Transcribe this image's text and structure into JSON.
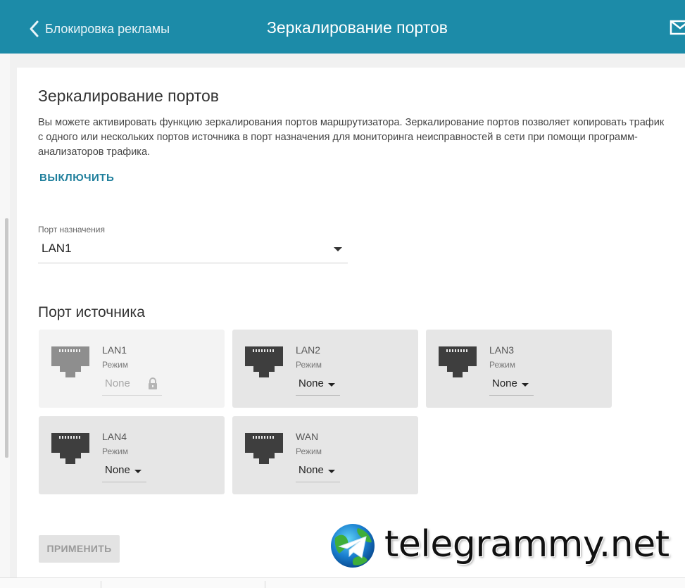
{
  "header": {
    "back_label": "Блокировка рекламы",
    "title": "Зеркалирование портов",
    "accent_color": "#1c8ba8"
  },
  "main": {
    "section_title": "Зеркалирование портов",
    "description": "Вы можете активировать функцию зеркалирования портов маршрутизатора. Зеркалирование портов позволяет копировать трафик с одного или нескольких портов источника в порт назначения для мониторинга неисправностей в сети при помощи программ-анализаторов трафика.",
    "disable_label": "ВЫКЛЮЧИТЬ",
    "destination": {
      "label": "Порт назначения",
      "value": "LAN1"
    },
    "source_title": "Порт источника",
    "ports": [
      {
        "name": "LAN1",
        "mode_label": "Режим",
        "value": "None",
        "disabled": true
      },
      {
        "name": "LAN2",
        "mode_label": "Режим",
        "value": "None",
        "disabled": false
      },
      {
        "name": "LAN3",
        "mode_label": "Режим",
        "value": "None",
        "disabled": false
      },
      {
        "name": "LAN4",
        "mode_label": "Режим",
        "value": "None",
        "disabled": false
      },
      {
        "name": "WAN",
        "mode_label": "Режим",
        "value": "None",
        "disabled": false
      }
    ],
    "apply_label": "ПРИМЕНИТЬ"
  },
  "watermark": {
    "text": "telegrammy.net"
  }
}
